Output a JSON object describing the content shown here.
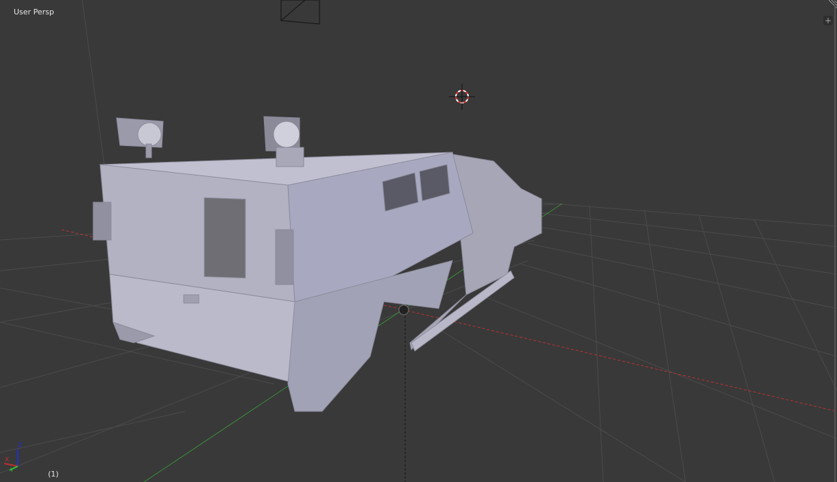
{
  "viewport": {
    "view_name": "User Persp",
    "frame": "(1)"
  },
  "axes": {
    "x": "X",
    "y": "Y",
    "z": "Z"
  },
  "colors": {
    "background": "#393939",
    "x_axis": "#c03030",
    "y_axis": "#40a040",
    "z_axis": "#2030d0",
    "mesh": "#b4b4c6"
  },
  "icons": [
    "plus-icon",
    "resize-corner-icon",
    "3d-cursor-icon",
    "camera-icon",
    "axis-gizmo-icon"
  ]
}
